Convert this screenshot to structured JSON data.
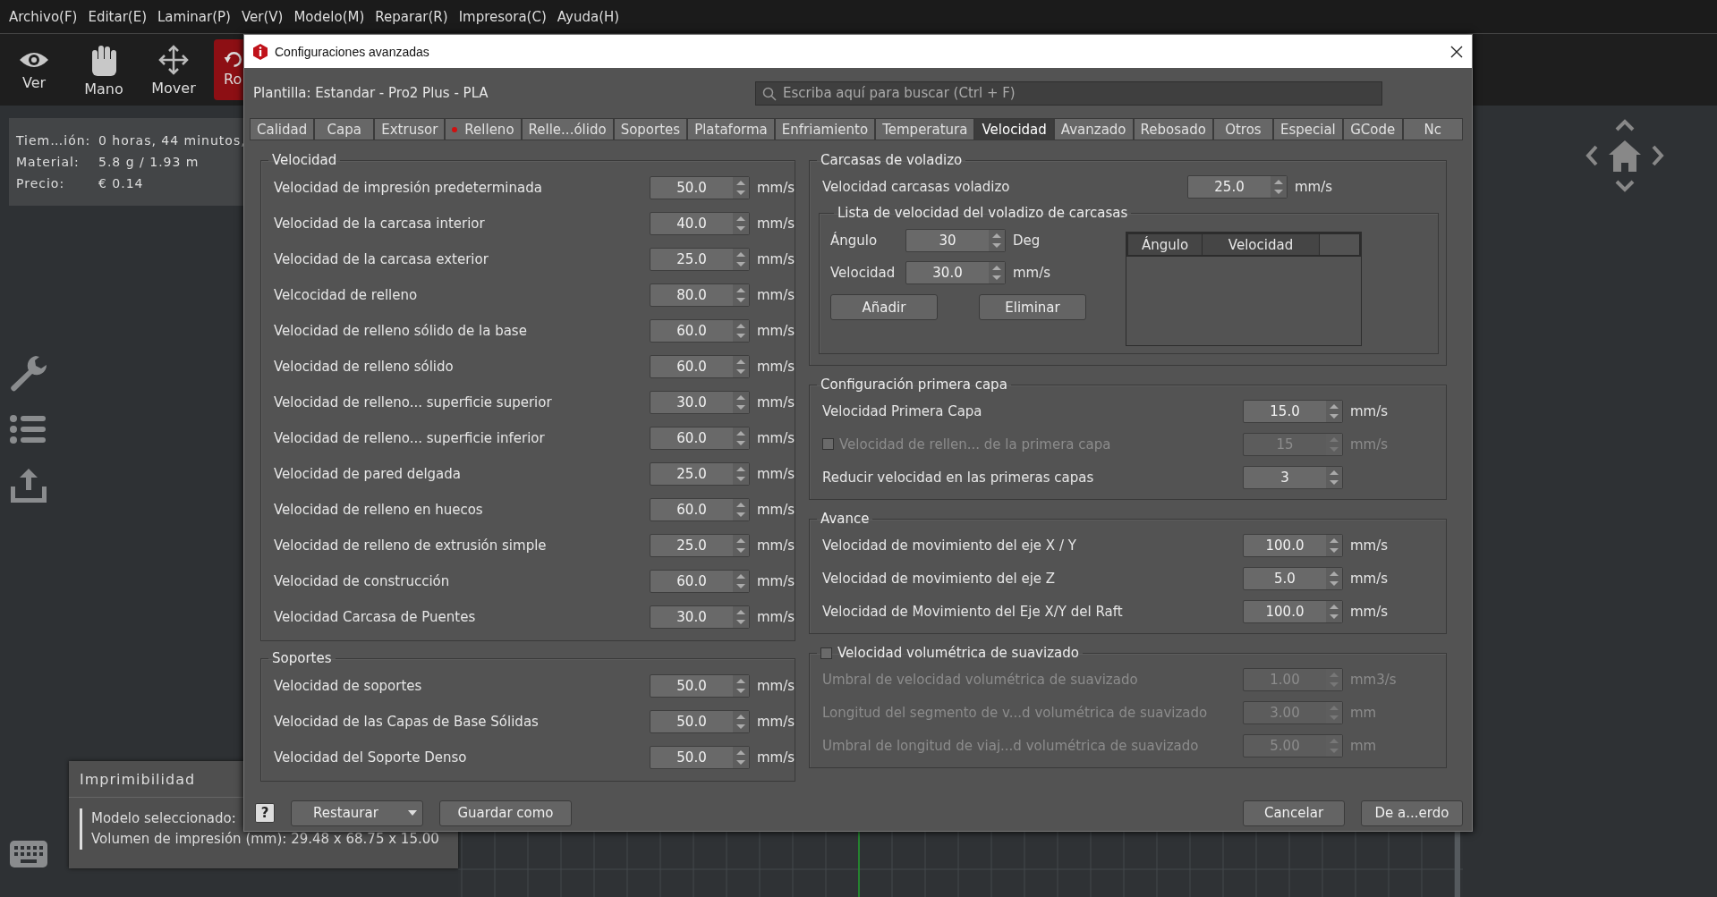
{
  "menu": [
    "Archivo(F)",
    "Editar(E)",
    "Laminar(P)",
    "Ver(V)",
    "Modelo(M)",
    "Reparar(R)",
    "Impresora(C)",
    "Ayuda(H)"
  ],
  "toolbar": [
    {
      "label": "Ver",
      "selected": false
    },
    {
      "label": "Mano",
      "selected": false
    },
    {
      "label": "Mover",
      "selected": false
    },
    {
      "label": "Ro",
      "selected": true
    }
  ],
  "print_info": [
    {
      "label": "Tiem…ión:",
      "value": "0 horas, 44 minutos,"
    },
    {
      "label": "Material:",
      "value": "5.8 g / 1.93 m"
    },
    {
      "label": "Precio:",
      "value": "€ 0.14"
    }
  ],
  "printability": {
    "title": "Imprimibilidad",
    "lines": [
      "Modelo seleccionado:",
      "Volumen de impresión (mm): 29.48 x 68.75 x 15.00"
    ]
  },
  "dialog": {
    "title": "Configuraciones avanzadas",
    "template": "Plantilla: Estandar - Pro2 Plus - PLA",
    "search": {
      "placeholder": "Escriba aquí para buscar (Ctrl + F)"
    },
    "tabs": [
      {
        "label": "Calidad",
        "selected": false,
        "modified": false
      },
      {
        "label": "Capa",
        "selected": false,
        "modified": false
      },
      {
        "label": "Extrusor",
        "selected": false,
        "modified": false
      },
      {
        "label": "Relleno",
        "selected": false,
        "modified": true
      },
      {
        "label": "Relle...ólido",
        "selected": false,
        "modified": false
      },
      {
        "label": "Soportes",
        "selected": false,
        "modified": false
      },
      {
        "label": "Plataforma",
        "selected": false,
        "modified": false
      },
      {
        "label": "Enfriamiento",
        "selected": false,
        "modified": false
      },
      {
        "label": "Temperatura",
        "selected": false,
        "modified": false
      },
      {
        "label": "Velocidad",
        "selected": true,
        "modified": false
      },
      {
        "label": "Avanzado",
        "selected": false,
        "modified": false
      },
      {
        "label": "Rebosado",
        "selected": false,
        "modified": false
      },
      {
        "label": "Otros",
        "selected": false,
        "modified": false
      },
      {
        "label": "Especial",
        "selected": false,
        "modified": false
      },
      {
        "label": "GCode",
        "selected": false,
        "modified": false
      },
      {
        "label": "Nc",
        "selected": false,
        "modified": false
      }
    ],
    "left_groups": [
      {
        "title": "Velocidad",
        "rows": [
          {
            "label": "Velocidad de impresión predeterminada",
            "value": "50.0",
            "unit": "mm/s"
          },
          {
            "label": "Velocidad de la carcasa interior",
            "value": "40.0",
            "unit": "mm/s"
          },
          {
            "label": "Velocidad de la carcasa exterior",
            "value": "25.0",
            "unit": "mm/s"
          },
          {
            "label": "Velcocidad de relleno",
            "value": "80.0",
            "unit": "mm/s"
          },
          {
            "label": "Velocidad de relleno sólido de la base",
            "value": "60.0",
            "unit": "mm/s"
          },
          {
            "label": "Velocidad de relleno sólido",
            "value": "60.0",
            "unit": "mm/s"
          },
          {
            "label": "Velocidad de relleno... superficie superior",
            "value": "30.0",
            "unit": "mm/s"
          },
          {
            "label": "Velocidad de relleno... superficie inferior",
            "value": "60.0",
            "unit": "mm/s"
          },
          {
            "label": "Velocidad de pared delgada",
            "value": "25.0",
            "unit": "mm/s"
          },
          {
            "label": "Velocidad de relleno en huecos",
            "value": "60.0",
            "unit": "mm/s"
          },
          {
            "label": "Velocidad de relleno de extrusión simple",
            "value": "25.0",
            "unit": "mm/s"
          },
          {
            "label": "Velocidad de construcción",
            "value": "60.0",
            "unit": "mm/s"
          },
          {
            "label": "Velocidad Carcasa de Puentes",
            "value": "30.0",
            "unit": "mm/s"
          }
        ]
      },
      {
        "title": "Soportes",
        "rows": [
          {
            "label": "Velocidad de soportes",
            "value": "50.0",
            "unit": "mm/s"
          },
          {
            "label": "Velocidad de las Capas de Base Sólidas",
            "value": "50.0",
            "unit": "mm/s"
          },
          {
            "label": "Velocidad del Soporte Denso",
            "value": "50.0",
            "unit": "mm/s"
          }
        ]
      }
    ],
    "overhang": {
      "title": "Carcasas de voladizo",
      "rows": [
        {
          "label": "Velocidad carcasas voladizo",
          "value": "25.0",
          "unit": "mm/s"
        }
      ],
      "list": {
        "title": "Lista de velocidad del voladizo de carcasas",
        "fields": [
          {
            "label": "Ángulo",
            "value": "30",
            "unit": "Deg"
          },
          {
            "label": "Velocidad",
            "value": "30.0",
            "unit": "mm/s"
          }
        ],
        "buttons": [
          "Añadir",
          "Eliminar"
        ],
        "columns": [
          "Ángulo",
          "Velocidad"
        ]
      }
    },
    "right_groups": [
      {
        "title": "Configuración primera capa",
        "kind": "plain",
        "rows": [
          {
            "kind": "spin",
            "label": "Velocidad Primera Capa",
            "value": "15.0",
            "unit": "mm/s",
            "disabled": false
          },
          {
            "kind": "check-spin",
            "checked": false,
            "label": "Velocidad de rellen... de la primera capa",
            "value": "15",
            "unit": "mm/s",
            "disabled": true
          },
          {
            "kind": "spin",
            "label": "Reducir velocidad en las primeras capas",
            "value": "3",
            "disabled": false
          }
        ]
      },
      {
        "title": "Avance",
        "kind": "plain",
        "rows": [
          {
            "kind": "spin",
            "label": "Velocidad de movimiento del eje X / Y",
            "value": "100.0",
            "unit": "mm/s",
            "disabled": false
          },
          {
            "kind": "spin",
            "label": "Velocidad de movimiento del eje Z",
            "value": "5.0",
            "unit": "mm/s",
            "disabled": false
          },
          {
            "kind": "spin",
            "label": "Velocidad de Movimiento del Eje X/Y del Raft",
            "value": "100.0",
            "unit": "mm/s",
            "disabled": false
          }
        ]
      },
      {
        "title": "Velocidad volumétrica de suavizado",
        "kind": "check",
        "checked": false,
        "rows": [
          {
            "kind": "spin",
            "label": "Umbral de velocidad volumétrica de suavizado",
            "value": "1.00",
            "unit": "mm3/s",
            "disabled": true
          },
          {
            "kind": "spin",
            "label": "Longitud del segmento de v...d volumétrica de suavizado",
            "value": "3.00",
            "unit": "mm",
            "disabled": true
          },
          {
            "kind": "spin",
            "label": "Umbral de longitud de viaj...d volumétrica de suavizado",
            "value": "5.00",
            "unit": "mm",
            "disabled": true
          }
        ]
      }
    ],
    "footer": {
      "left": [
        {
          "label": "?",
          "kind": "help"
        },
        {
          "label": "Restaurar",
          "kind": "dropdown"
        },
        {
          "label": "Guardar como",
          "kind": "plain"
        }
      ],
      "right": [
        {
          "label": "Cancelar",
          "kind": "plain"
        },
        {
          "label": "De a...erdo",
          "kind": "plain"
        }
      ]
    }
  }
}
